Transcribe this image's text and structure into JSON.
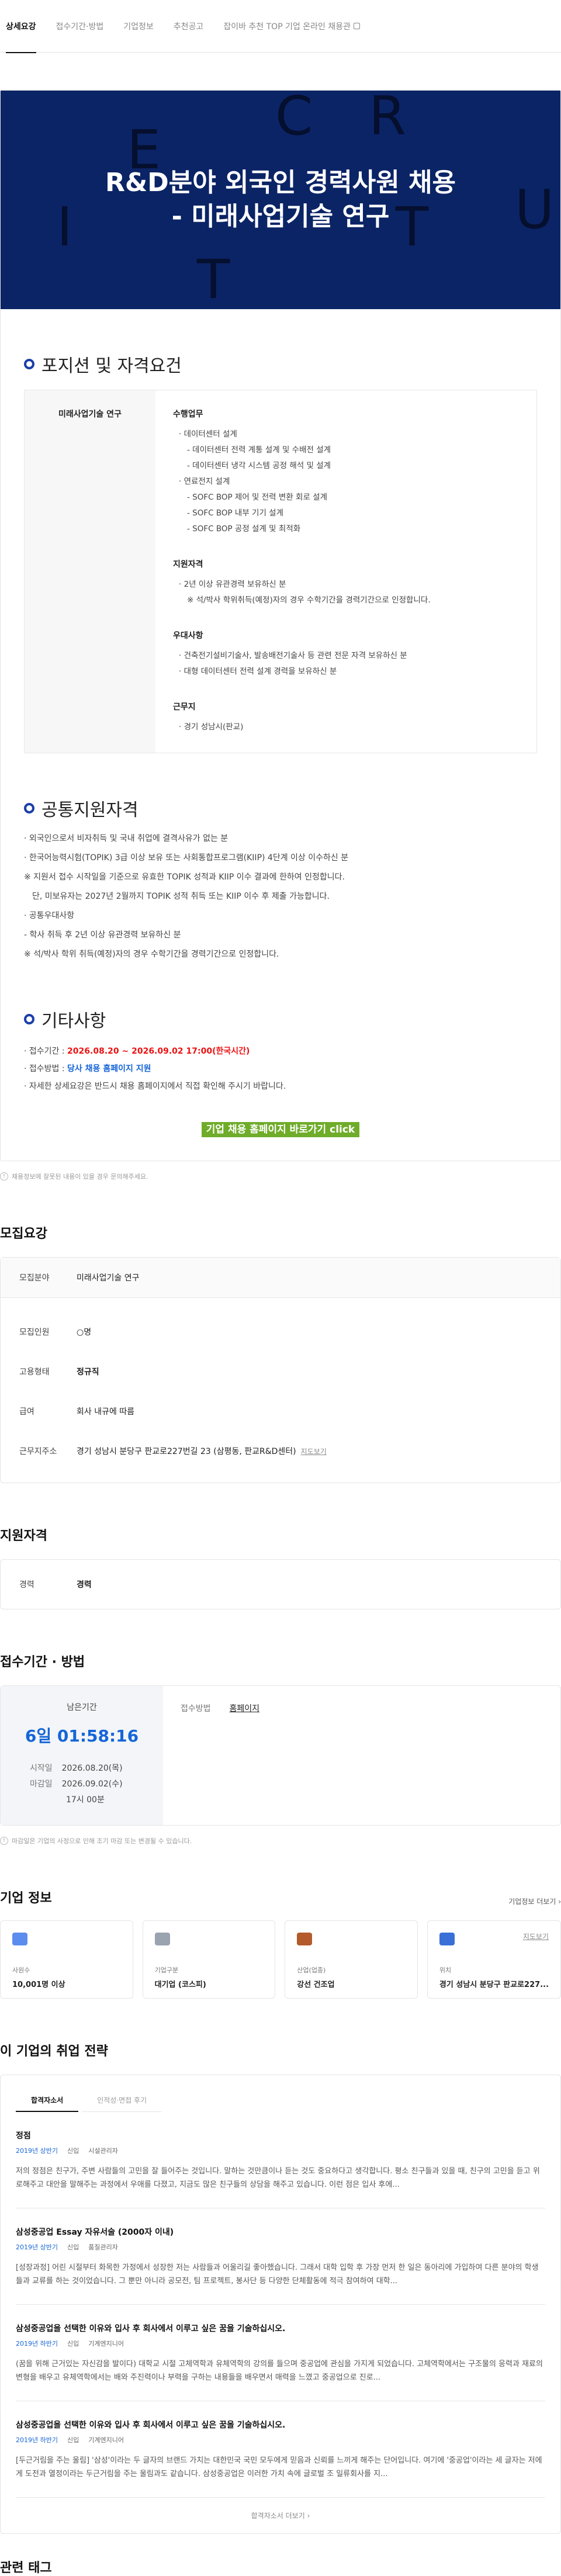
{
  "tabs": [
    {
      "label": "상세요강"
    },
    {
      "label": "접수기간·방법"
    },
    {
      "label": "기업정보"
    },
    {
      "label": "추천공고"
    },
    {
      "label": "잡이바 추천 TOP 기업 온라인 채용관"
    }
  ],
  "banner": {
    "title_line1": "R&D분야 외국인 경력사원 채용",
    "title_line2": "- 미래사업기술 연구",
    "letters": [
      "E",
      "C",
      "R",
      "I",
      "T",
      "R",
      "U",
      "T"
    ]
  },
  "position": {
    "heading": "포지션 및 자격요건",
    "left_label": "미래사업기술 연구",
    "duty_h": "수행업무",
    "duty": [
      "· 데이터센터 설계",
      "- 데이터센터 전력 계통 설계 및 수배전 설계",
      "- 데이터센터 냉각 시스템 공정 해석 및 설계",
      "· 연료전지 설계",
      "- SOFC BOP 제어 및 전력 변환 회로 설계",
      "- SOFC BOP 내부 기기 설계",
      "- SOFC BOP 공정 설계 및 최적화"
    ],
    "req_h": "지원자격",
    "req": [
      "· 2년 이상 유관경력 보유하신 분",
      "※ 석/박사 학위취득(예정)자의 경우 수학기간을 경력기간으로 인정합니다."
    ],
    "pref_h": "우대사항",
    "pref": [
      "· 건축전기설비기술사, 발송배전기술사 등 관련 전문 자격 보유하신 분",
      "· 대형 데이터센터 전력 설계 경력을 보유하신 분"
    ],
    "loc_h": "근무지",
    "loc": [
      "· 경기 성남시(판교)"
    ]
  },
  "common": {
    "heading": "공통지원자격",
    "items": [
      "· 외국인으로서 비자취득 및 국내 취업에 결격사유가 없는 분",
      "· 한국어능력시험(TOPIK) 3급 이상 보유 또는 사회통합프로그램(KIIP) 4단계 이상 이수하신 분",
      "※ 지원서 접수 시작일을 기준으로 유효한 TOPIK 성적과 KIIP 이수 결과에 한하여 인정합니다.",
      "단, 미보유자는 2027년 2월까지 TOPIK 성적 취득 또는 KIIP 이수 후 제출 가능합니다.",
      "· 공통우대사항",
      "- 학사 취득 후 2년 이상 유관경력 보유하신 분",
      "※ 석/박사 학위 취득(예정)자의 경우 수학기간을 경력기간으로 인정합니다."
    ]
  },
  "etc": {
    "heading": "기타사항",
    "period_label": "· 접수기간 : ",
    "period_value": "2026.08.20 ~ 2026.09.02 17:00(한국시간)",
    "method_label": "· 접수방법 : ",
    "method_value": "당사 채용 홈페이지 지원",
    "detail": "· 자세한 상세요강은 반드시 채용 홈페이지에서 직접 확인해 주시기 바랍니다.",
    "cta": "기업 채용 홈페이지 바로가기 click"
  },
  "notice1": "채용정보에 잘못된 내용이 있을 경우 문의해주세요.",
  "recruit": {
    "heading": "모집요강",
    "field_k": "모집분야",
    "field_v": "미래사업기술 연구",
    "count_k": "모집인원",
    "count_v": "○명",
    "type_k": "고용형태",
    "type_v": "정규직",
    "pay_k": "급여",
    "pay_v": "회사 내규에 따름",
    "addr_k": "근무지주소",
    "addr_v": "경기 성남시 분당구 판교로227번길 23 (삼평동, 판교R&D센터)",
    "map": "지도보기"
  },
  "qualif": {
    "heading": "지원자격",
    "k": "경력",
    "v": "경력"
  },
  "apply": {
    "heading": "접수기간 · 방법",
    "remain_label": "남은기간",
    "countdown": "6일 01:58:16",
    "start_k": "시작일",
    "start_v": "2026.08.20(목)",
    "end_k": "마감일",
    "end_v": "2026.09.02(수)",
    "end_time": "17시 00분",
    "method_k": "접수방법",
    "method_v": "홈페이지",
    "notice": "마감일은 기업의 사정으로 인해 조기 마감 또는 변경될 수 있습니다."
  },
  "corp": {
    "heading": "기업 정보",
    "more": "기업정보 더보기",
    "cards": [
      {
        "label": "사원수",
        "value": "10,001명 이상",
        "icon": "people-icon"
      },
      {
        "label": "기업구분",
        "value": "대기업 (코스피)",
        "icon": "building-icon"
      },
      {
        "label": "산업(업종)",
        "value": "강선 건조업",
        "icon": "briefcase-icon"
      },
      {
        "label": "위치",
        "value": "경기 성남시 분당구 판교로227...",
        "icon": "pin-icon",
        "link": "지도보기"
      }
    ]
  },
  "strategy": {
    "heading": "이 기업의 취업 전략",
    "tabs": [
      "합격자소서",
      "인적성·면접 후기"
    ],
    "essays": [
      {
        "title": "정점",
        "year": "2019년 상반기",
        "type": "신입",
        "job": "시설관리자",
        "text": "저의 정점은 친구가, 주변 사람들의 고민을 잘 들어주는 것입니다. 말하는 것만큼이나 듣는 것도 중요하다고 생각합니다. 평소 친구들과 있을 때, 친구의 고민을 듣고 위로해주고 대안을 말해주는 과정에서 우애를 다졌고, 지금도 많은 친구들의 상담을 해주고 있습니다. 이런 점은 입사 후에..."
      },
      {
        "title": "삼성중공업 Essay 자유서술 (2000자 이내)",
        "year": "2019년 상반기",
        "type": "신입",
        "job": "품질관리자",
        "text": "[성장과정] 어린 시절부터 화목한 가정에서 성장한 저는 사람들과 어울리길 좋아했습니다. 그래서 대학 입학 후 가장 먼저 한 일은 동아리에 가입하여 다른 분야의 학생들과 교류를 하는 것이었습니다. 그 뿐만 아니라 공모전, 팀 프로젝트, 봉사단 등 다양한 단체활동에 적극 참여하여 대학..."
      },
      {
        "title": "삼성중공업을 선택한 이유와 입사 후 회사에서 이루고 싶은 꿈을 기술하십시오.",
        "year": "2019년 하반기",
        "type": "신입",
        "job": "기계엔지니어",
        "text": "(꿈을 위해 근거있는 자신감을 발이다) 대학교 시절 고체역학과 유체역학의 강의를 들으며 중공업에 관심을 가지게 되었습니다. 고체역학에서는 구조물의 응력과 재료의 변형을 배우고 유체역학에서는 배와 주진력이나 부력을 구하는 내용들을 배우면서 매력을 느꼈고 중공업으로 진로..."
      },
      {
        "title": "삼성중공업을 선택한 이유와 입사 후 회사에서 이루고 싶은 꿈을 기술하십시오.",
        "year": "2019년 하반기",
        "type": "신입",
        "job": "기계엔지니어",
        "text": "[두근거림을 주는 울림] '삼성'이라는 두 글자의 브랜드 가치는 대한민국 국민 모두에게 믿음과 신뢰를 느끼게 해주는 단어입니다. 여기에 '중공업'이라는 세 글자는 저에게 도전과 열정이라는 두근거림을 주는 울림과도 같습니다. 삼성중공업은 이러한 가치 속에 글로벌 조 일류회사를 지..."
      }
    ],
    "more": "합격자소서 더보기"
  },
  "tags_heading": "관련 태그"
}
